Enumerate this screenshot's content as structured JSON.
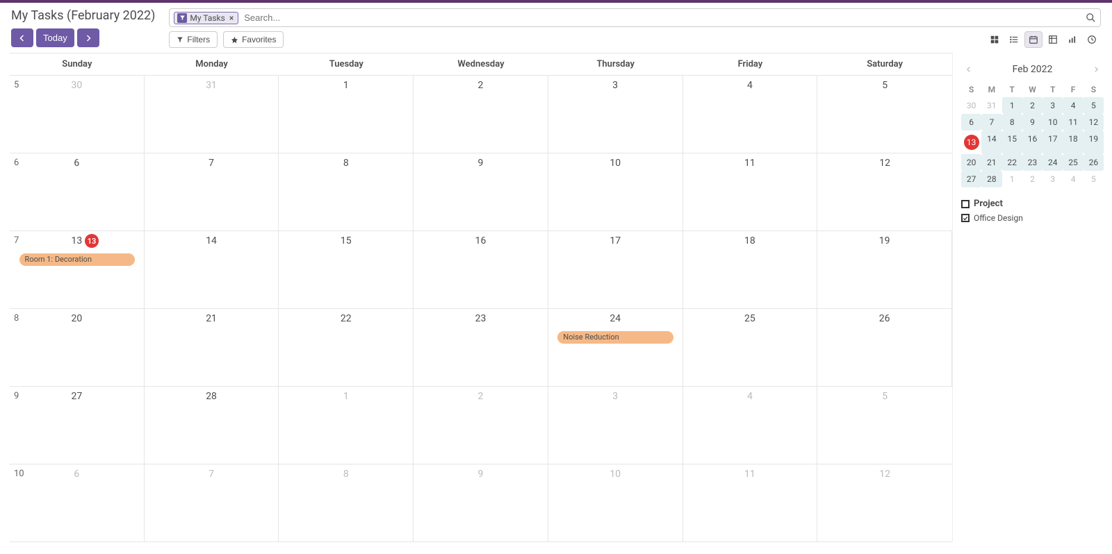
{
  "header": {
    "title": "My Tasks (February 2022)",
    "search_chip": "My Tasks",
    "search_placeholder": "Search...",
    "filters_label": "Filters",
    "favorites_label": "Favorites",
    "today_label": "Today"
  },
  "views": {
    "kanban": "kanban",
    "list": "list",
    "calendar": "calendar",
    "pivot": "pivot",
    "graph": "graph",
    "activity": "activity"
  },
  "calendar": {
    "day_headers": [
      "Sunday",
      "Monday",
      "Tuesday",
      "Wednesday",
      "Thursday",
      "Friday",
      "Saturday"
    ],
    "weeks": [
      {
        "num": "5",
        "days": [
          {
            "n": "30",
            "muted": true
          },
          {
            "n": "31",
            "muted": true
          },
          {
            "n": "1"
          },
          {
            "n": "2"
          },
          {
            "n": "3"
          },
          {
            "n": "4"
          },
          {
            "n": "5"
          }
        ]
      },
      {
        "num": "6",
        "days": [
          {
            "n": "6"
          },
          {
            "n": "7"
          },
          {
            "n": "8"
          },
          {
            "n": "9"
          },
          {
            "n": "10"
          },
          {
            "n": "11"
          },
          {
            "n": "12"
          }
        ]
      },
      {
        "num": "7",
        "today_badge": "13",
        "days": [
          {
            "n": "13"
          },
          {
            "n": "14"
          },
          {
            "n": "15"
          },
          {
            "n": "16"
          },
          {
            "n": "17"
          },
          {
            "n": "18"
          },
          {
            "n": "19"
          }
        ],
        "events": [
          {
            "label": "Room 1: Decoration",
            "start": 0,
            "span": 1
          }
        ]
      },
      {
        "num": "8",
        "days": [
          {
            "n": "20"
          },
          {
            "n": "21"
          },
          {
            "n": "22"
          },
          {
            "n": "23"
          },
          {
            "n": "24"
          },
          {
            "n": "25"
          },
          {
            "n": "26"
          }
        ],
        "events": [
          {
            "label": "Noise Reduction",
            "start": 4,
            "span": 1
          }
        ]
      },
      {
        "num": "9",
        "days": [
          {
            "n": "27"
          },
          {
            "n": "28"
          },
          {
            "n": "1",
            "muted": true
          },
          {
            "n": "2",
            "muted": true
          },
          {
            "n": "3",
            "muted": true
          },
          {
            "n": "4",
            "muted": true
          },
          {
            "n": "5",
            "muted": true
          }
        ]
      },
      {
        "num": "10",
        "days": [
          {
            "n": "6",
            "muted": true
          },
          {
            "n": "7",
            "muted": true
          },
          {
            "n": "8",
            "muted": true
          },
          {
            "n": "9",
            "muted": true
          },
          {
            "n": "10",
            "muted": true
          },
          {
            "n": "11",
            "muted": true
          },
          {
            "n": "12",
            "muted": true
          }
        ]
      }
    ]
  },
  "mini": {
    "title": "Feb 2022",
    "day_headers": [
      "S",
      "M",
      "T",
      "W",
      "T",
      "F",
      "S"
    ],
    "rows": [
      [
        {
          "n": "30",
          "muted": true
        },
        {
          "n": "31",
          "muted": true
        },
        {
          "n": "1",
          "in": true
        },
        {
          "n": "2",
          "in": true
        },
        {
          "n": "3",
          "in": true
        },
        {
          "n": "4",
          "in": true
        },
        {
          "n": "5",
          "in": true
        }
      ],
      [
        {
          "n": "6",
          "in": true
        },
        {
          "n": "7",
          "in": true
        },
        {
          "n": "8",
          "in": true
        },
        {
          "n": "9",
          "in": true
        },
        {
          "n": "10",
          "in": true
        },
        {
          "n": "11",
          "in": true
        },
        {
          "n": "12",
          "in": true
        }
      ],
      [
        {
          "n": "13",
          "in": true,
          "today": true
        },
        {
          "n": "14",
          "in": true
        },
        {
          "n": "15",
          "in": true
        },
        {
          "n": "16",
          "in": true
        },
        {
          "n": "17",
          "in": true
        },
        {
          "n": "18",
          "in": true
        },
        {
          "n": "19",
          "in": true
        }
      ],
      [
        {
          "n": "20",
          "in": true
        },
        {
          "n": "21",
          "in": true
        },
        {
          "n": "22",
          "in": true
        },
        {
          "n": "23",
          "in": true
        },
        {
          "n": "24",
          "in": true
        },
        {
          "n": "25",
          "in": true
        },
        {
          "n": "26",
          "in": true
        }
      ],
      [
        {
          "n": "27",
          "in": true
        },
        {
          "n": "28",
          "in": true
        },
        {
          "n": "1",
          "muted": true
        },
        {
          "n": "2",
          "muted": true
        },
        {
          "n": "3",
          "muted": true
        },
        {
          "n": "4",
          "muted": true
        },
        {
          "n": "5",
          "muted": true
        }
      ]
    ]
  },
  "filters": {
    "group_label": "Project",
    "items": [
      {
        "label": "Office Design",
        "checked": true
      }
    ]
  }
}
